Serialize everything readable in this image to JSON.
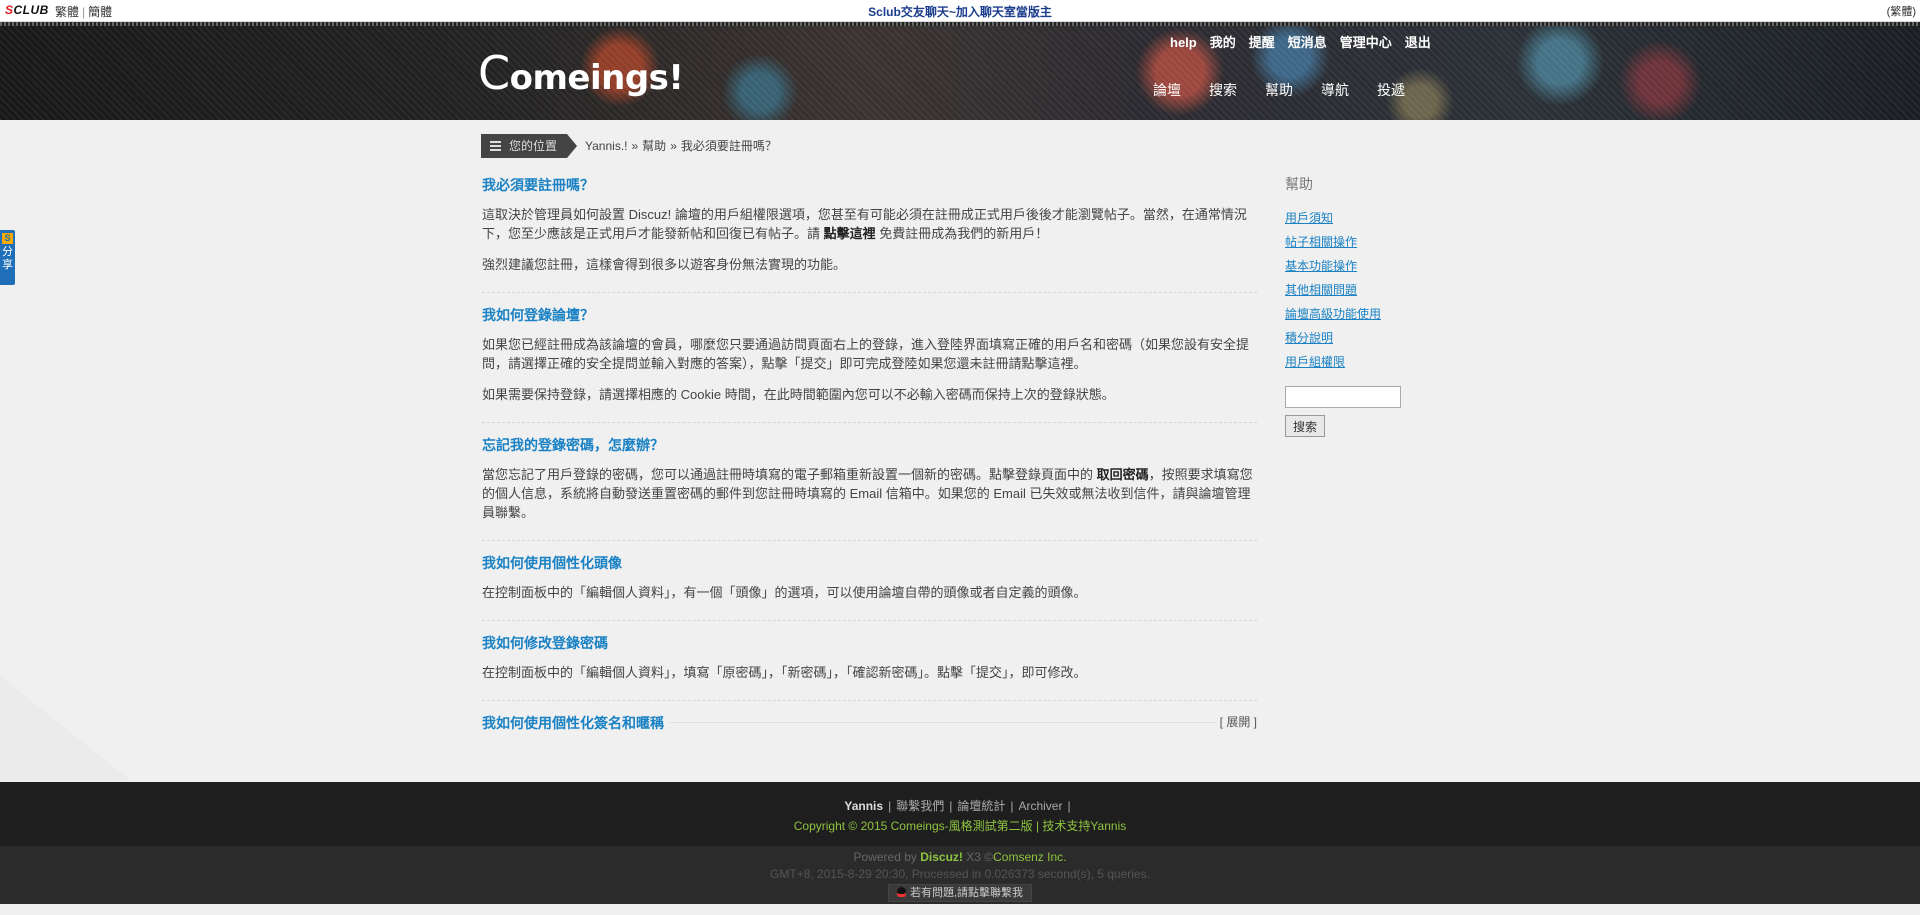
{
  "topbar": {
    "logo_prefix": "S",
    "logo_rest": "CLUB",
    "lang_traditional": "繁體",
    "lang_simplified": "簡體",
    "notice": "Sclub交友聊天~加入聊天室當版主",
    "right_text": "(繁體)"
  },
  "banner": {
    "brand_initial": "C",
    "brand_rest": "omeings!",
    "user_links": [
      "help",
      "我的",
      "提醒",
      "短消息",
      "管理中心",
      "退出"
    ],
    "nav": [
      "論壇",
      "搜索",
      "幫助",
      "導航",
      "投遞"
    ]
  },
  "share": {
    "badge": "S",
    "label": "分享"
  },
  "breadcrumb": {
    "label": "您的位置",
    "items": [
      "Yannis.!",
      "幫助",
      "我必須要註冊嗎？"
    ],
    "separator": "»"
  },
  "faqs": [
    {
      "question": "我必須要註冊嗎？",
      "p1": "這取決於管理員如何設置 Discuz! 論壇的用戶組權限選項，您甚至有可能必須在註冊成正式用戶後後才能瀏覽帖子。當然，在通常情況下，您至少應該是正式用戶才能發新帖和回復已有帖子。請 ",
      "p1_bold": "點擊這裡",
      "p1_tail": " 免費註冊成為我們的新用戶！",
      "p2": "強烈建議您註冊，這樣會得到很多以遊客身份無法實現的功能。"
    },
    {
      "question": "我如何登錄論壇？",
      "p1": "如果您已經註冊成為該論壇的會員，哪麼您只要通過訪問頁面右上的登錄，進入登陸界面填寫正確的用戶名和密碼（如果您設有安全提問，請選擇正確的安全提問並輸入對應的答案），點擊「提交」即可完成登陸如果您還未註冊請點擊這裡。",
      "p2": "如果需要保持登錄，請選擇相應的 Cookie 時間，在此時間範圍內您可以不必輸入密碼而保持上次的登錄狀態。"
    },
    {
      "question": "忘記我的登錄密碼，怎麼辦？",
      "p1": "當您忘記了用戶登錄的密碼，您可以通過註冊時填寫的電子郵箱重新設置一個新的密碼。點擊登錄頁面中的 ",
      "p1_bold": "取回密碼",
      "p1_tail": "，按照要求填寫您的個人信息，系統將自動發送重置密碼的郵件到您註冊時填寫的 Email 信箱中。如果您的 Email 已失效或無法收到信件，請與論壇管理員聯繫。"
    },
    {
      "question": "我如何使用個性化頭像",
      "p1": "在控制面板中的「編輯個人資料」，有一個「頭像」的選項，可以使用論壇自帶的頭像或者自定義的頭像。"
    },
    {
      "question": "我如何修改登錄密碼",
      "p1": "在控制面板中的「編輯個人資料」，填寫「原密碼」，「新密碼」，「確認新密碼」。點擊「提交」，即可修改。"
    },
    {
      "question": "我如何使用個性化簽名和暱稱",
      "expand": "[ 展開 ]"
    }
  ],
  "sidebar": {
    "title": "幫助",
    "links": [
      "用戶須知",
      "帖子相關操作",
      "基本功能操作",
      "其他相關問題",
      "論壇高級功能使用",
      "積分說明",
      "用戶組權限"
    ],
    "search_value": "",
    "search_button": "搜索"
  },
  "footer": {
    "site": "Yannis",
    "links": [
      "聯繫我們",
      "論壇統計",
      "Archiver"
    ],
    "copyright": "Copyright © 2015 Comeings-風格測試第二版 | 技术支持Yannis",
    "powered_prefix": "Powered by ",
    "powered_brand": "Discuz!",
    "powered_version": " X3 ©",
    "powered_company": "Comsenz Inc.",
    "gmt": "GMT+8, 2015-8-29 20:30, Processed in 0.026373 second(s), 5 queries.",
    "qq_text": "若有問題,請點擊聯繫我"
  },
  "colors": {
    "link_blue": "#1a82c4",
    "footer_green": "#8ec43f",
    "notice_blue": "#1a3c8c"
  }
}
